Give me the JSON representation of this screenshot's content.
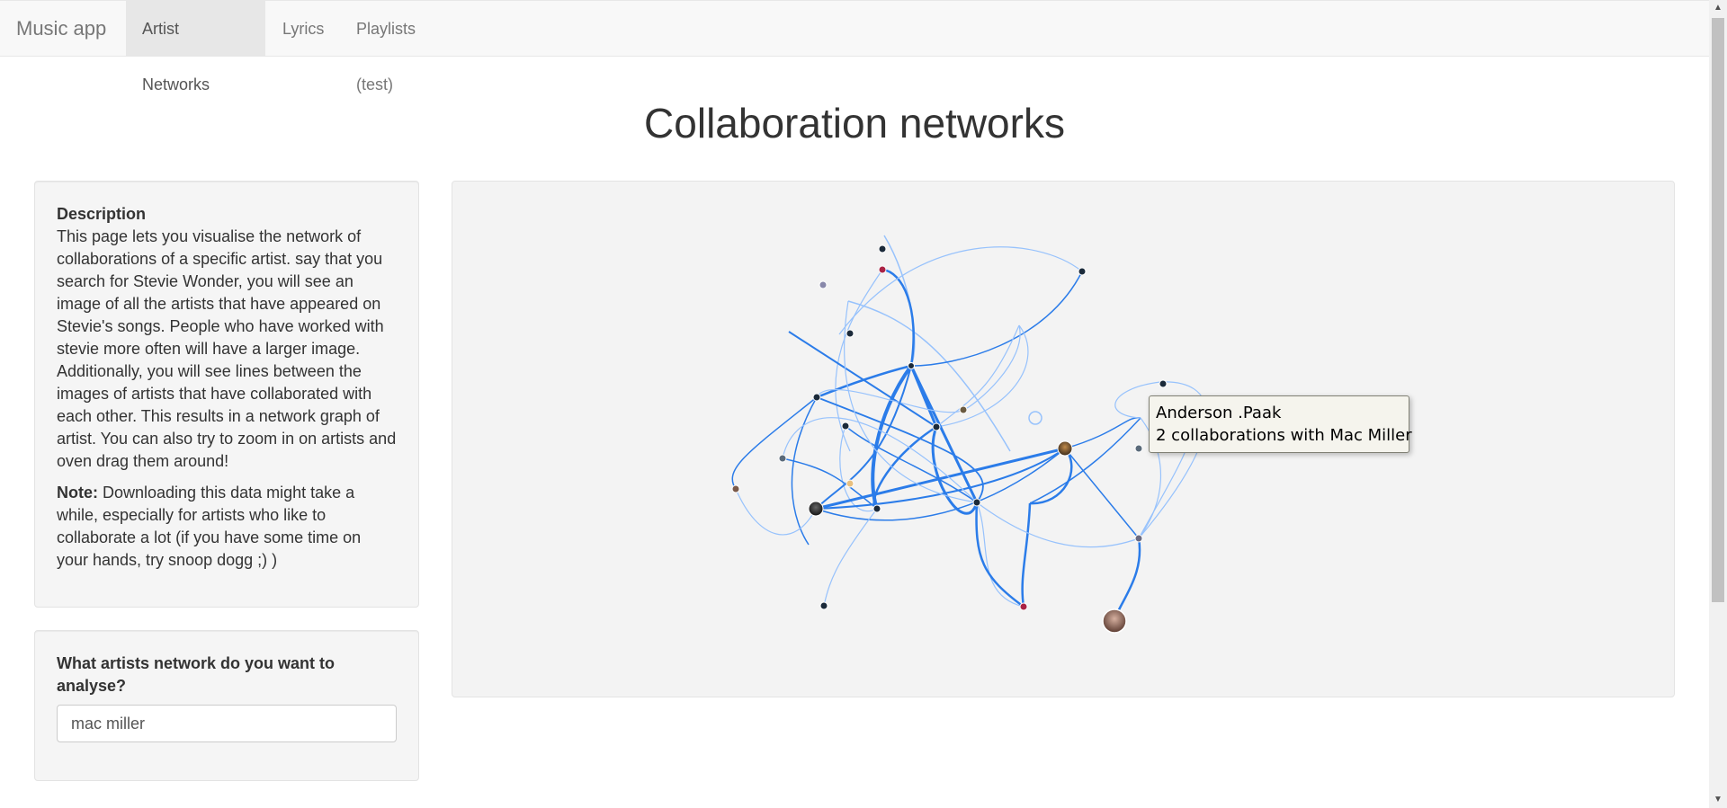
{
  "navbar": {
    "brand": "Music app",
    "tabs": [
      {
        "label": "Artist Networks",
        "active": true
      },
      {
        "label": "Lyrics",
        "active": false
      },
      {
        "label": "Playlists (test)",
        "active": false
      }
    ]
  },
  "page": {
    "title": "Collaboration networks"
  },
  "description": {
    "heading": "Description",
    "body": "This page lets you visualise the network of collaborations of a specific artist. say that you search for Stevie Wonder, you will see an image of all the artists that have appeared on Stevie's songs. People who have worked with stevie more often will have a larger image. Additionally, you will see lines between the images of artists that have collaborated with each other. This results in a network graph of artist. You can also try to zoom in on artists and oven drag them around!",
    "note_label": "Note:",
    "note_body": " Downloading this data might take a while, especially for artists who like to collaborate a lot (if you have some time on your hands, try snoop dogg ;) )"
  },
  "search": {
    "label": "What artists network do you want to analyse?",
    "value": "mac miller"
  },
  "tooltip": {
    "artist": "Anderson .Paak",
    "detail": "2 collaborations with Mac Miller"
  },
  "colors": {
    "edge": "#2b7ce9",
    "edge_light": "#97c2fc",
    "node_dark": "#1b2a3a"
  }
}
